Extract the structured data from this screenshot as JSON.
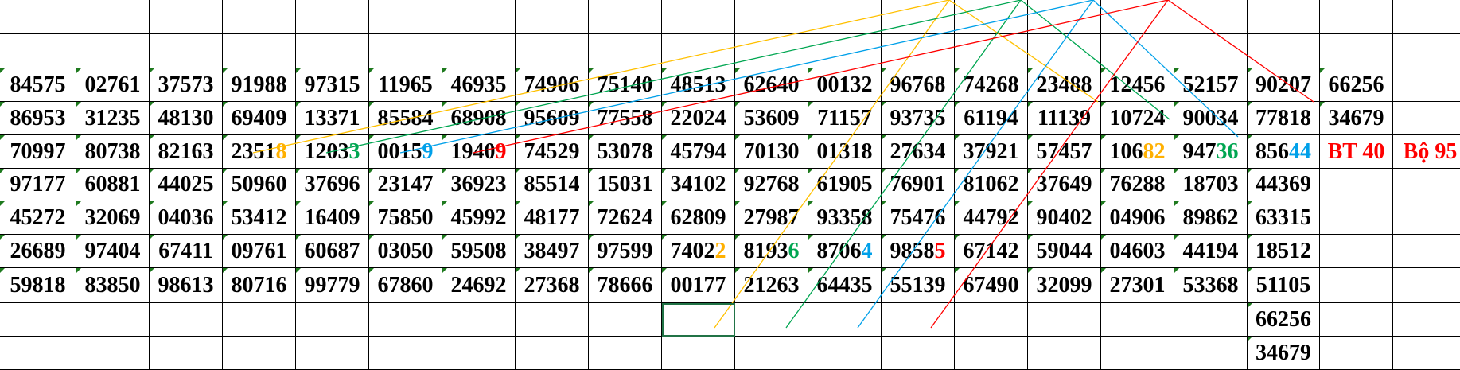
{
  "sheet": {
    "rows": [
      [
        "",
        "",
        "",
        "",
        "",
        "",
        "",
        "",
        "",
        "",
        "",
        "",
        "",
        "",
        "",
        "",
        "",
        "",
        "",
        "",
        ""
      ],
      [
        "",
        "",
        "",
        "",
        "",
        "",
        "",
        "",
        "",
        "",
        "",
        "",
        "",
        "",
        "",
        "",
        "",
        "",
        "",
        "",
        ""
      ],
      [
        "84575",
        "02761",
        "37573",
        "91988",
        "97315",
        "11965",
        "46935",
        "74906",
        "75140",
        "48513",
        "62640",
        "00132",
        "96768",
        "74268",
        "23488",
        "12456",
        "52157",
        "90207",
        "66256",
        "",
        ""
      ],
      [
        "86953",
        "31235",
        "48130",
        "69409",
        "13371",
        "85584",
        "68908",
        "95609",
        "77558",
        "22024",
        "53609",
        "71157",
        "93735",
        "61194",
        "11139",
        "10724",
        "90034",
        "77818",
        "34679",
        "",
        ""
      ],
      [
        "70997",
        "80738",
        "82163",
        "23518",
        "12033",
        "00159",
        "19409",
        "74529",
        "53078",
        "45794",
        "70130",
        "01318",
        "27634",
        "37921",
        "57457",
        "10682",
        "94736",
        "85644",
        "BT 40",
        "Bộ 95",
        ""
      ],
      [
        "97177",
        "60881",
        "44025",
        "50960",
        "37696",
        "23147",
        "36923",
        "85514",
        "15031",
        "34102",
        "92768",
        "61905",
        "76901",
        "81062",
        "37649",
        "76288",
        "18703",
        "44369",
        "",
        "",
        ""
      ],
      [
        "45272",
        "32069",
        "04036",
        "53412",
        "16409",
        "75850",
        "45992",
        "48177",
        "72624",
        "62809",
        "27987",
        "93358",
        "75476",
        "44792",
        "90402",
        "04906",
        "89862",
        "63315",
        "",
        "",
        ""
      ],
      [
        "26689",
        "97404",
        "67411",
        "09761",
        "60687",
        "03050",
        "59508",
        "38497",
        "97599",
        "74022",
        "81936",
        "87064",
        "98585",
        "67142",
        "59044",
        "04603",
        "44194",
        "18512",
        "",
        "",
        ""
      ],
      [
        "59818",
        "83850",
        "98613",
        "80716",
        "99779",
        "67860",
        "24692",
        "27368",
        "78666",
        "00177",
        "21263",
        "64435",
        "55139",
        "67490",
        "32099",
        "27301",
        "53368",
        "51105",
        "",
        "",
        ""
      ],
      [
        "",
        "",
        "",
        "",
        "",
        "",
        "",
        "",
        "",
        "",
        "",
        "",
        "",
        "",
        "",
        "",
        "",
        "66256",
        "",
        "",
        ""
      ],
      [
        "",
        "",
        "",
        "",
        "",
        "",
        "",
        "",
        "",
        "",
        "",
        "",
        "",
        "",
        "",
        "",
        "",
        "34679",
        "",
        "",
        ""
      ]
    ],
    "highlights": [
      {
        "r": 4,
        "c": 3,
        "digits": 1,
        "color": "#ffb000"
      },
      {
        "r": 4,
        "c": 4,
        "digits": 1,
        "color": "#00a651"
      },
      {
        "r": 4,
        "c": 5,
        "digits": 1,
        "color": "#00a0e9"
      },
      {
        "r": 4,
        "c": 6,
        "digits": 1,
        "color": "#ff0000"
      },
      {
        "r": 4,
        "c": 15,
        "digits": 2,
        "color": "#ffb000"
      },
      {
        "r": 4,
        "c": 16,
        "digits": 2,
        "color": "#00a651"
      },
      {
        "r": 4,
        "c": 17,
        "digits": 2,
        "color": "#00a0e9"
      },
      {
        "r": 7,
        "c": 9,
        "digits": 1,
        "color": "#ffb000"
      },
      {
        "r": 7,
        "c": 10,
        "digits": 1,
        "color": "#00a651"
      },
      {
        "r": 7,
        "c": 11,
        "digits": 1,
        "color": "#00a0e9"
      },
      {
        "r": 7,
        "c": 12,
        "digits": 1,
        "color": "#ff0000"
      }
    ],
    "tag_color": "#ff0000",
    "line_colors": [
      "#ffc000",
      "#00a651",
      "#00a0e9",
      "#ff0000"
    ]
  }
}
